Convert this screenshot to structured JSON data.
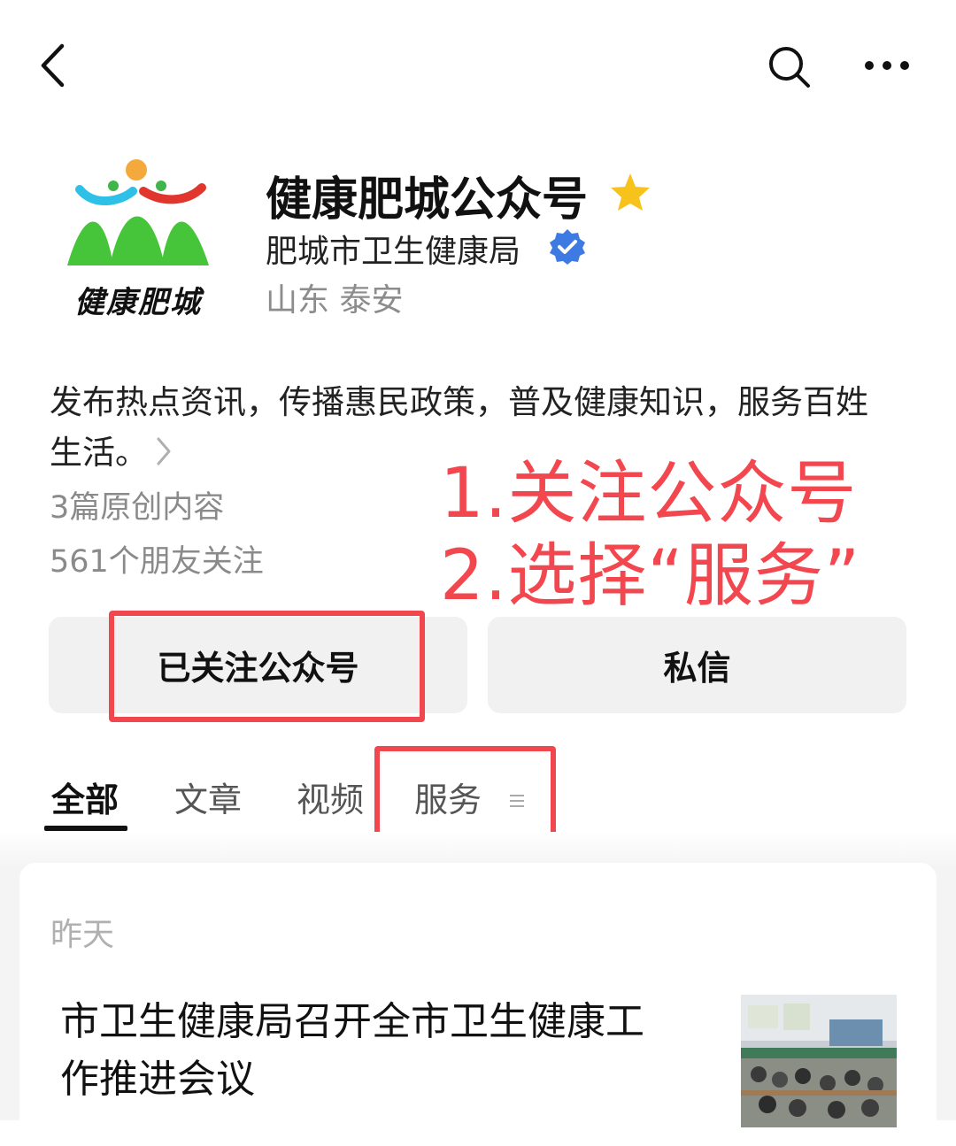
{
  "account": {
    "name": "健康肥城公众号",
    "org": "肥城市卫生健康局",
    "location": "山东 泰安",
    "logo_text": "健康肥城",
    "description_line1": "发布热点资讯，传播惠民政策，普及健康知识，服务百姓",
    "description_line2": "生活。",
    "original_count": "3篇原创内容",
    "followers": "561个朋友关注"
  },
  "buttons": {
    "follow_label": "已关注公众号",
    "message_label": "私信"
  },
  "tabs": [
    {
      "label": "全部",
      "active": true
    },
    {
      "label": "文章",
      "active": false
    },
    {
      "label": "视频",
      "active": false
    },
    {
      "label": "服务",
      "active": false
    }
  ],
  "annotations": {
    "step1": "1.关注公众号",
    "step2": "2.选择“服务”",
    "color": "#f2474f"
  },
  "feed": {
    "date": "昨天",
    "article_title_line1": "市卫生健康局召开全市卫生健康工",
    "article_title_line2": "作推进会议"
  },
  "icons": {
    "back": "chevron-left-icon",
    "search": "search-icon",
    "more": "more-dots-icon",
    "star": "star-icon",
    "verified": "verified-badge-icon",
    "desc_arrow": "chevron-right-icon",
    "menu": "menu-lines-icon"
  },
  "colors": {
    "star": "#f7c21c",
    "verified": "#3d7be3",
    "accent_red": "#f2474f"
  }
}
